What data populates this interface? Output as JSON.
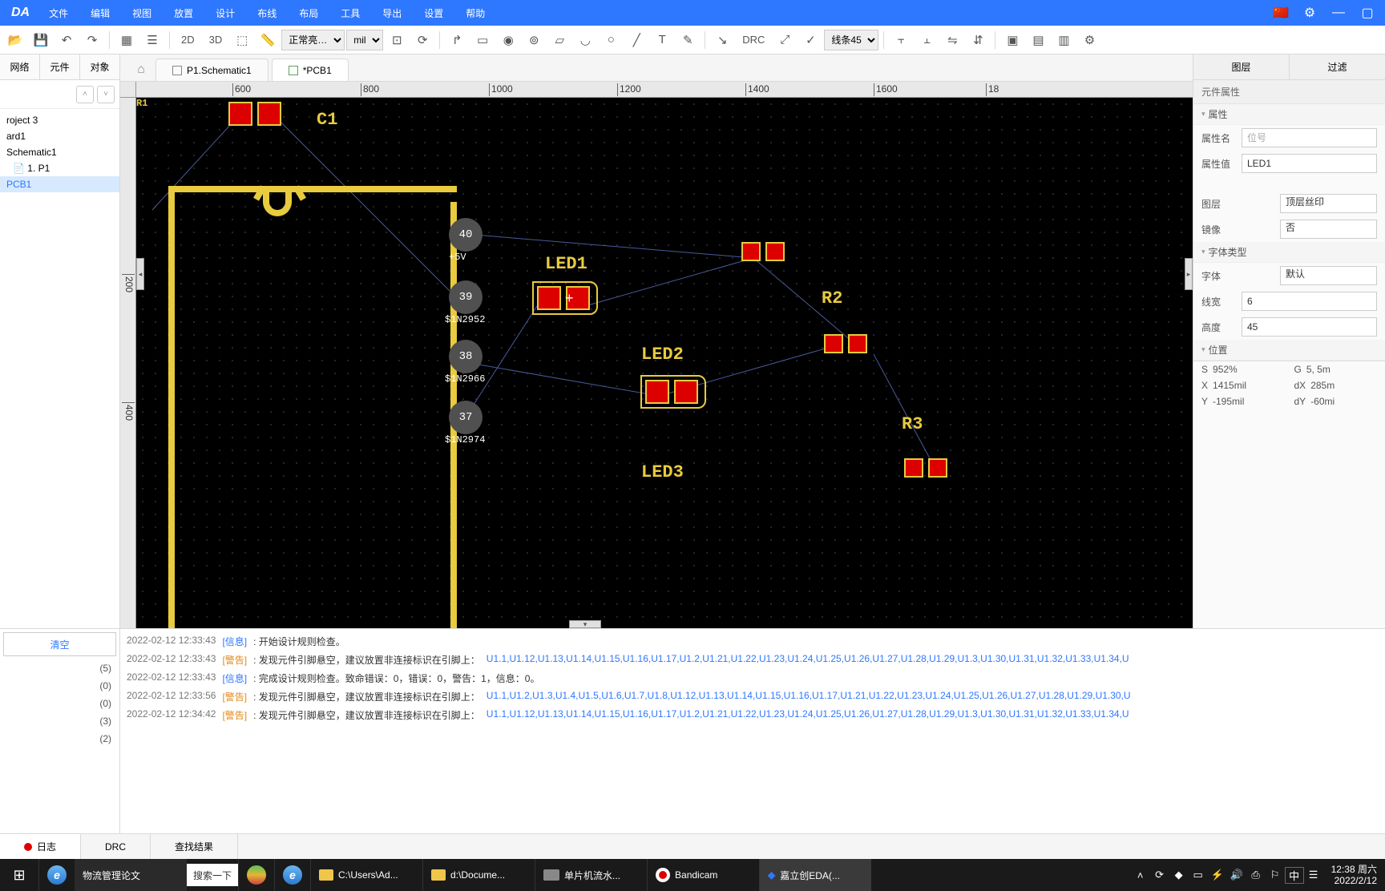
{
  "menubar": {
    "logo": "DA",
    "items": [
      "文件",
      "编辑",
      "视图",
      "放置",
      "设计",
      "布线",
      "布局",
      "工具",
      "导出",
      "设置",
      "帮助"
    ],
    "flag": "🇨🇳"
  },
  "toolbar": {
    "view_2d": "2D",
    "view_3d": "3D",
    "brightness": "正常亮…",
    "unit": "mil",
    "drc": "DRC",
    "line_mode": "线条45"
  },
  "left": {
    "tabs": [
      "网络",
      "元件",
      "对象"
    ],
    "tree": {
      "project": "roject 3",
      "board": "ard1",
      "schematic": "Schematic1",
      "page": "1. P1",
      "pcb": "PCB1"
    }
  },
  "docs": {
    "tab1": "P1.Schematic1",
    "tab2": "*PCB1"
  },
  "ruler_h": [
    "600",
    "800",
    "1000",
    "1200",
    "1400",
    "1600",
    "18"
  ],
  "ruler_v": [
    "200",
    "400"
  ],
  "pcb_labels": {
    "C1": "C1",
    "R1": "R1",
    "R2": "R2",
    "R3": "R3",
    "LED1": "LED1",
    "LED2": "LED2",
    "LED3": "LED3",
    "p40": "40",
    "p39": "39",
    "p38": "38",
    "p37": "37",
    "n5v": "+5V",
    "n2952": "$1N2952",
    "n2966": "$1N2966",
    "n2974": "$1N2974"
  },
  "right": {
    "tabs": [
      "图层",
      "过滤"
    ],
    "section": "元件属性",
    "group_attr": "属性",
    "name_label": "属性名",
    "name_ph": "位号",
    "value_label": "属性值",
    "value": "LED1",
    "layer_label": "图层",
    "layer": "顶层丝印",
    "mirror_label": "镜像",
    "mirror": "否",
    "group_font": "字体类型",
    "font_label": "字体",
    "font": "默认",
    "lw_label": "线宽",
    "lw": "6",
    "h_label": "高度",
    "h": "45",
    "group_pos": "位置",
    "S_l": "S",
    "S": "952%",
    "G_l": "G",
    "G": "5, 5m",
    "X_l": "X",
    "X": "1415mil",
    "dX_l": "dX",
    "dX": "285m",
    "Y_l": "Y",
    "Y": "-195mil",
    "dY_l": "dY",
    "dY": "-60mi"
  },
  "log_left": {
    "clear": "清空",
    "cats": [
      [
        "",
        "(5)"
      ],
      [
        "",
        "(0)"
      ],
      [
        "",
        "(0)"
      ],
      [
        "",
        "(3)"
      ],
      [
        "",
        "(2)"
      ]
    ]
  },
  "log": [
    {
      "ts": "2022-02-12 12:33:43",
      "tag": "[信息]",
      "cls": "info",
      "msg": ": 开始设计规则检查。"
    },
    {
      "ts": "2022-02-12 12:33:43",
      "tag": "[警告]",
      "cls": "warn",
      "msg": ": 发现元件引脚悬空，建议放置非连接标识在引脚上：",
      "links": "U1.1,U1.12,U1.13,U1.14,U1.15,U1.16,U1.17,U1.2,U1.21,U1.22,U1.23,U1.24,U1.25,U1.26,U1.27,U1.28,U1.29,U1.3,U1.30,U1.31,U1.32,U1.33,U1.34,U"
    },
    {
      "ts": "2022-02-12 12:33:43",
      "tag": "[信息]",
      "cls": "info",
      "msg": ": 完成设计规则检查。致命错误：0，错误：0，警告：1，信息：0。"
    },
    {
      "ts": "2022-02-12 12:33:56",
      "tag": "[警告]",
      "cls": "warn",
      "msg": ": 发现元件引脚悬空，建议放置非连接标识在引脚上：",
      "links": "U1.1,U1.2,U1.3,U1.4,U1.5,U1.6,U1.7,U1.8,U1.12,U1.13,U1.14,U1.15,U1.16,U1.17,U1.21,U1.22,U1.23,U1.24,U1.25,U1.26,U1.27,U1.28,U1.29,U1.30,U"
    },
    {
      "ts": "2022-02-12 12:34:42",
      "tag": "[警告]",
      "cls": "warn",
      "msg": ": 发现元件引脚悬空，建议放置非连接标识在引脚上：",
      "links": "U1.1,U1.12,U1.13,U1.14,U1.15,U1.16,U1.17,U1.2,U1.21,U1.22,U1.23,U1.24,U1.25,U1.26,U1.27,U1.28,U1.29,U1.3,U1.30,U1.31,U1.32,U1.33,U1.34,U"
    }
  ],
  "bottom_tabs": {
    "log": "日志",
    "drc": "DRC",
    "find": "查找结果"
  },
  "taskbar": {
    "link": "物流管理论文",
    "search": "搜索一下",
    "app1": "C:\\Users\\Ad...",
    "app2": "d:\\Docume...",
    "app3": "单片机流水...",
    "app4": "Bandicam",
    "app5": "嘉立创EDA(...",
    "ime": "中",
    "kb": "☰",
    "time": "12:38 周六",
    "date": "2022/2/12"
  }
}
